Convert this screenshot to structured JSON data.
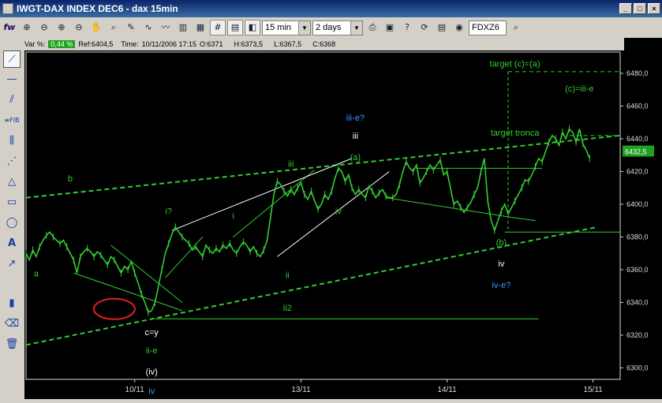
{
  "window": {
    "title": "IWGT-DAX INDEX DEC6 -  dax 15min"
  },
  "toolbar": {
    "logo": "fw",
    "interval": "15 min",
    "range": "2 days",
    "symbol": "FDXZ6"
  },
  "infobar": {
    "var_label": "Var %:",
    "var_value": "0,44 %",
    "ref": "Ref:6404,5",
    "time_label": "Time:",
    "time_value": "10/11/2006 17:15",
    "open": "O:6371",
    "high": "H:6373,5",
    "low": "L:6367,5",
    "close": "C:6368"
  },
  "colors": {
    "background": "#000000",
    "price": "#33cc33",
    "annotation_green": "#33cc33",
    "annotation_blue": "#3399ff",
    "annotation_white": "#ffffff",
    "ellipse": "#dd2222",
    "last_price_box": "#1fa21f"
  },
  "chart_data": {
    "type": "line",
    "title": "",
    "ylim": [
      6293,
      6493
    ],
    "y_ticks": [
      "6300,0",
      "6320,0",
      "6340,0",
      "6360,0",
      "6380,0",
      "6400,0",
      "6420,0",
      "6440,0",
      "6460,0",
      "6480,0"
    ],
    "x_ticks": [
      "10/11",
      "13/11",
      "14/11",
      "15/11"
    ],
    "last_price": "6432,5",
    "series": [
      {
        "values": [
          6370,
          6366,
          6372,
          6368,
          6374,
          6378,
          6381,
          6383,
          6380,
          6378,
          6376,
          6378,
          6374,
          6370,
          6366,
          6358,
          6368,
          6371,
          6373,
          6371,
          6368,
          6371,
          6369,
          6366,
          6363,
          6368,
          6366,
          6362,
          6358,
          6362,
          6360,
          6365,
          6358,
          6352,
          6345,
          6340,
          6334,
          6335,
          6340,
          6350,
          6360,
          6370,
          6376,
          6382,
          6386,
          6383,
          6380,
          6378,
          6376,
          6372,
          6374,
          6371,
          6368,
          6375,
          6372,
          6370,
          6373,
          6371,
          6375,
          6373,
          6376,
          6372,
          6370,
          6374,
          6377,
          6375,
          6371,
          6374,
          6370,
          6368,
          6372,
          6378,
          6392,
          6406,
          6414,
          6412,
          6408,
          6405,
          6409,
          6406,
          6410,
          6413,
          6406,
          6403,
          6408,
          6402,
          6397,
          6400,
          6406,
          6403,
          6408,
          6416,
          6422,
          6420,
          6414,
          6418,
          6410,
          6406,
          6409,
          6406,
          6404,
          6411,
          6408,
          6404,
          6407,
          6409,
          6405,
          6404,
          6404,
          6406,
          6412,
          6420,
          6426,
          6422,
          6420,
          6424,
          6413,
          6416,
          6420,
          6424,
          6421,
          6424,
          6427,
          6418,
          6420,
          6410,
          6400,
          6402,
          6398,
          6395,
          6398,
          6401,
          6406,
          6410,
          6420,
          6428,
          6402,
          6390,
          6384,
          6390,
          6396,
          6400,
          6394,
          6398,
          6402,
          6406,
          6410,
          6415,
          6414,
          6418,
          6423,
          6428,
          6426,
          6432,
          6438,
          6442,
          6440,
          6436,
          6444,
          6440,
          6446,
          6444,
          6438,
          6446,
          6437,
          6433,
          6428
        ],
        "x_range": [
          0,
          175
        ]
      }
    ],
    "levels": [
      {
        "label": "target (c)=(a)",
        "value": 6481
      },
      {
        "label": "target tronca",
        "value": 6442
      }
    ],
    "annotations": [
      {
        "text": "a",
        "color": "green",
        "x": 3,
        "y": 6356
      },
      {
        "text": "b",
        "color": "green",
        "x": 13,
        "y": 6414
      },
      {
        "text": "c=y",
        "color": "white",
        "x": 37,
        "y": 6320
      },
      {
        "text": "ii-e",
        "color": "green",
        "x": 37,
        "y": 6309
      },
      {
        "text": "(iv)",
        "color": "white",
        "x": 37,
        "y": 6296
      },
      {
        "text": "iv",
        "color": "blue",
        "x": 37,
        "y": 6284
      },
      {
        "text": "i?",
        "color": "green",
        "x": 42,
        "y": 6394
      },
      {
        "text": "i",
        "color": "green",
        "x": 61,
        "y": 6391
      },
      {
        "text": "ii",
        "color": "green",
        "x": 77,
        "y": 6355
      },
      {
        "text": "ii2",
        "color": "green",
        "x": 77,
        "y": 6335
      },
      {
        "text": "iii",
        "color": "green",
        "x": 78,
        "y": 6423
      },
      {
        "text": "iii-e?",
        "color": "blue",
        "x": 97,
        "y": 6451
      },
      {
        "text": "iii",
        "color": "white",
        "x": 97,
        "y": 6440
      },
      {
        "text": "(a)",
        "color": "green",
        "x": 97,
        "y": 6427
      },
      {
        "text": "iv",
        "color": "green",
        "x": 92,
        "y": 6394
      },
      {
        "text": "(b)",
        "color": "green",
        "x": 140,
        "y": 6375
      },
      {
        "text": "iv",
        "color": "white",
        "x": 140,
        "y": 6362
      },
      {
        "text": "iv-e?",
        "color": "blue",
        "x": 140,
        "y": 6349
      },
      {
        "text": "(c)=iii-e",
        "color": "green",
        "x": 163,
        "y": 6469
      }
    ]
  }
}
